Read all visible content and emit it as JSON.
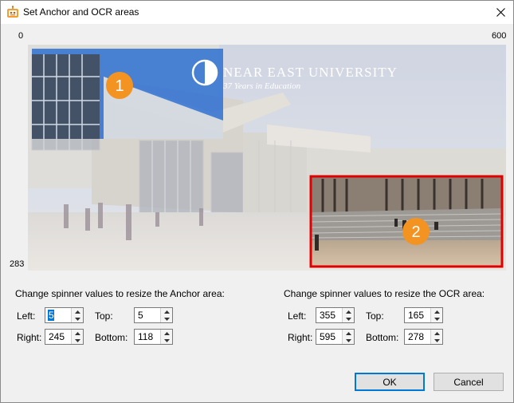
{
  "window": {
    "title": "Set Anchor and OCR areas"
  },
  "scale": {
    "x_min": "0",
    "x_max": "600",
    "y_max": "283"
  },
  "image": {
    "banner_title": "NEAR EAST UNIVERSITY",
    "banner_subtitle": "37 Years in Education",
    "anchor_marker": "1",
    "ocr_marker": "2",
    "anchor_highlight_color": "#0050c8",
    "ocr_border_color": "#e00000",
    "marker_color": "#f39322"
  },
  "anchor": {
    "heading": "Change spinner values to resize the Anchor area:",
    "left_label": "Left:",
    "left_value": "5",
    "top_label": "Top:",
    "top_value": "5",
    "right_label": "Right:",
    "right_value": "245",
    "bottom_label": "Bottom:",
    "bottom_value": "118"
  },
  "ocr": {
    "heading": "Change spinner values to resize the OCR area:",
    "left_label": "Left:",
    "left_value": "355",
    "top_label": "Top:",
    "top_value": "165",
    "right_label": "Right:",
    "right_value": "595",
    "bottom_label": "Bottom:",
    "bottom_value": "278"
  },
  "buttons": {
    "ok": "OK",
    "cancel": "Cancel"
  }
}
